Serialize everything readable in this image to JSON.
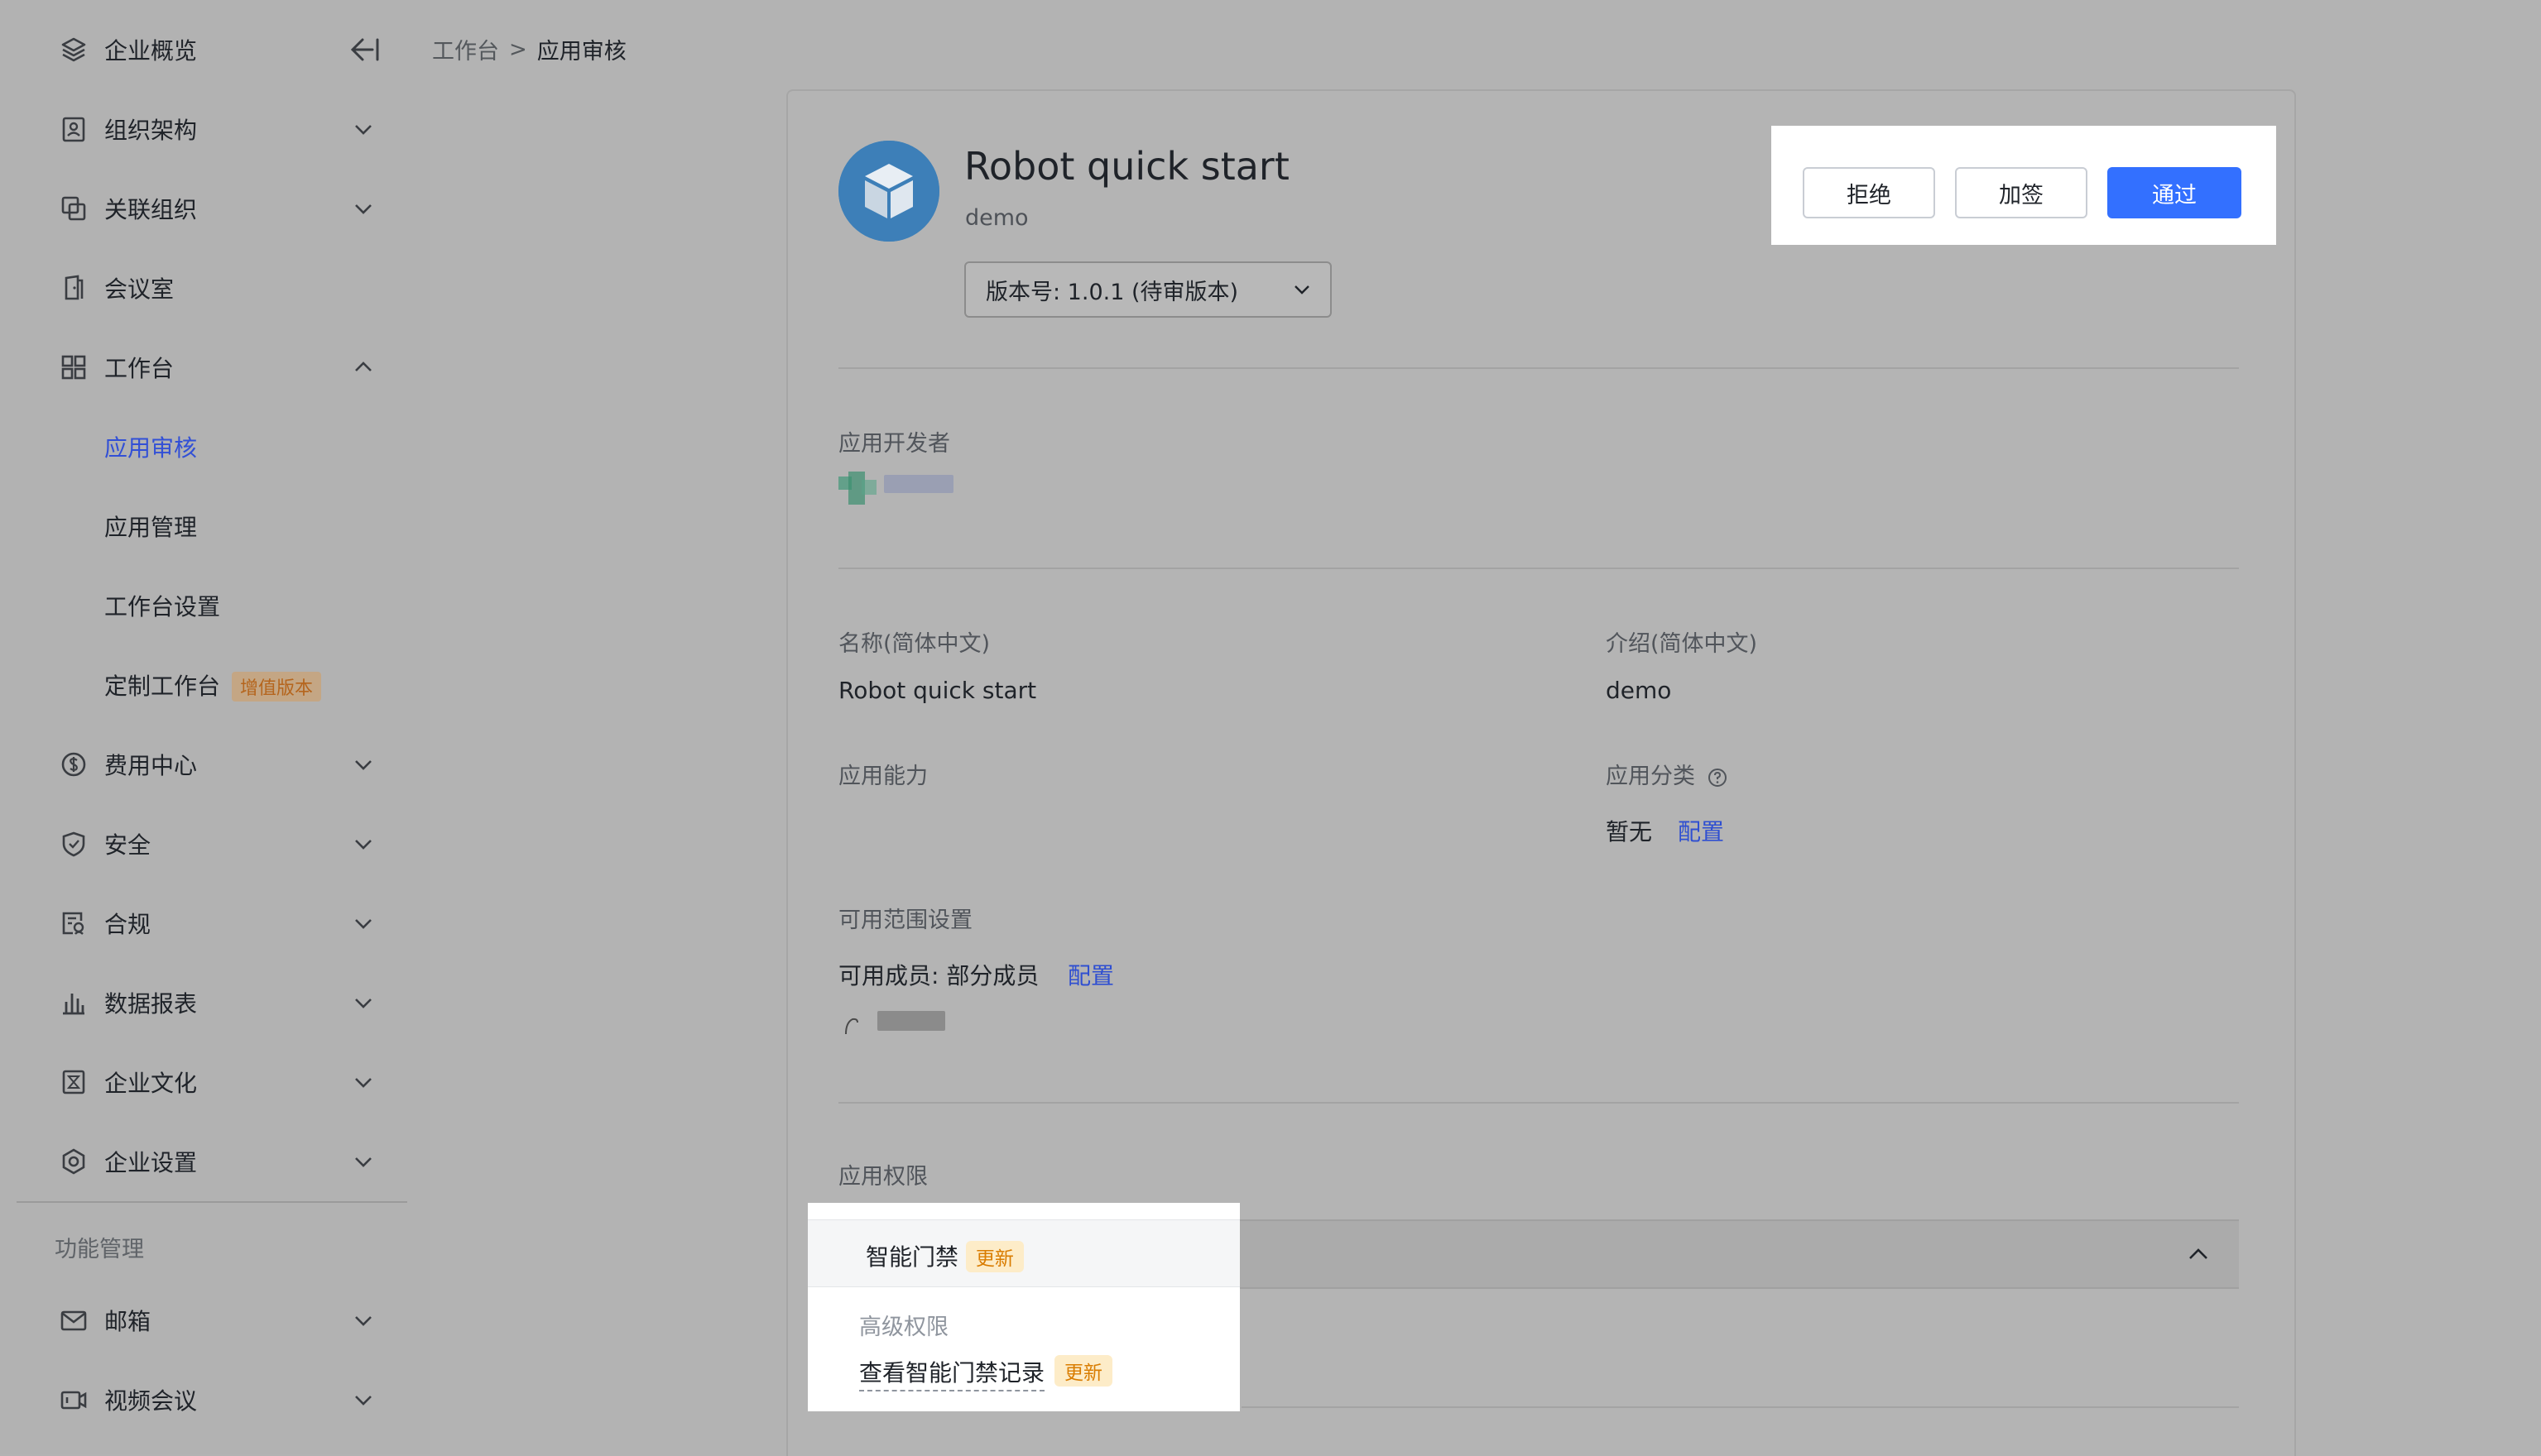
{
  "sidebar": {
    "items": [
      {
        "label": "企业概览",
        "icon": "layers-icon"
      },
      {
        "label": "组织架构",
        "icon": "contact-card-icon"
      },
      {
        "label": "关联组织",
        "icon": "linked-org-icon"
      },
      {
        "label": "会议室",
        "icon": "door-icon"
      },
      {
        "label": "工作台",
        "icon": "grid-icon"
      },
      {
        "label": "应用审核"
      },
      {
        "label": "应用管理"
      },
      {
        "label": "工作台设置"
      },
      {
        "label": "定制工作台",
        "badge": "增值版本"
      },
      {
        "label": "费用中心",
        "icon": "dollar-icon"
      },
      {
        "label": "安全",
        "icon": "shield-icon"
      },
      {
        "label": "合规",
        "icon": "compliance-icon"
      },
      {
        "label": "数据报表",
        "icon": "bar-chart-icon"
      },
      {
        "label": "企业文化",
        "icon": "culture-icon"
      },
      {
        "label": "企业设置",
        "icon": "settings-hex-icon"
      }
    ],
    "section_title": "功能管理",
    "section_items": [
      {
        "label": "邮箱",
        "icon": "mail-icon"
      },
      {
        "label": "视频会议",
        "icon": "video-icon"
      }
    ]
  },
  "breadcrumb": {
    "parent": "工作台",
    "separator": ">",
    "current": "应用审核"
  },
  "app": {
    "title": "Robot quick start",
    "subtitle": "demo",
    "version": "版本号: 1.0.1 (待审版本)"
  },
  "actions": {
    "reject": "拒绝",
    "countersign": "加签",
    "approve": "通过"
  },
  "developer": {
    "label": "应用开发者"
  },
  "info": {
    "name_label": "名称(简体中文)",
    "name_value": "Robot quick start",
    "intro_label": "介绍(简体中文)",
    "intro_value": "demo",
    "ability_label": "应用能力",
    "category_label": "应用分类",
    "category_value": "暂无",
    "category_link": "配置",
    "scope_label": "可用范围设置",
    "scope_members": "可用成员: 部分成员",
    "scope_link": "配置"
  },
  "permissions": {
    "label": "应用权限",
    "group_title": "智能门禁",
    "group_badge": "更新",
    "sub_title": "高级权限",
    "item_label": "查看智能门禁记录",
    "item_badge": "更新"
  },
  "colors": {
    "primary": "#3370ff",
    "link": "#2f4fd1",
    "badge_update_bg": "#fdecc8",
    "badge_update_fg": "#d97c00"
  }
}
